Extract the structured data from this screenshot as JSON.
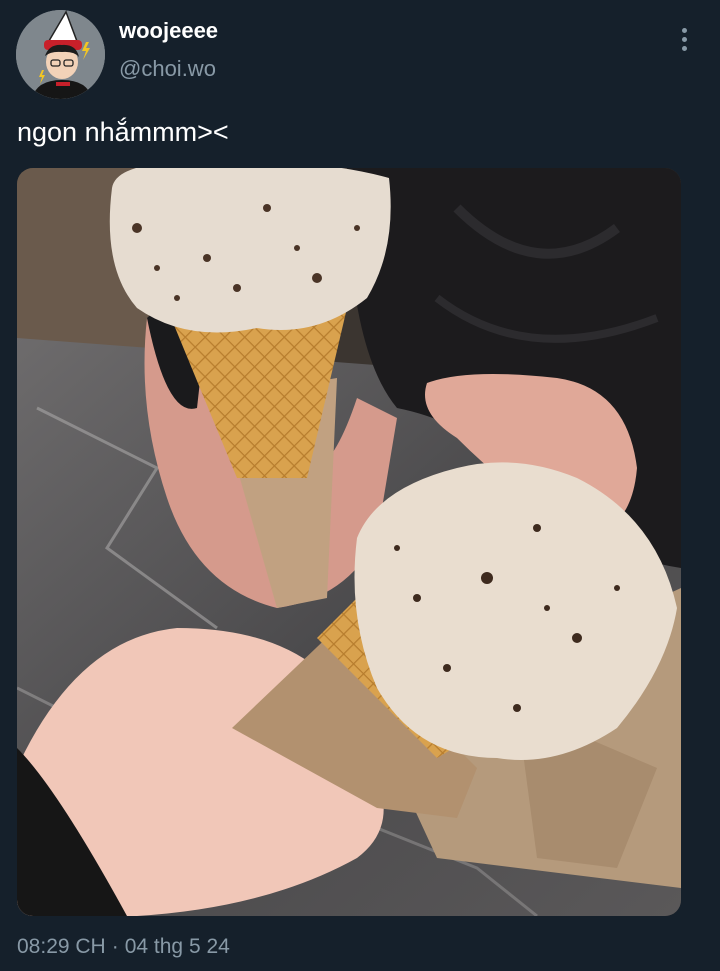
{
  "author": {
    "display_name": "woojeeee",
    "handle": "@choi.wo",
    "avatar_icon": "user-avatar"
  },
  "more_icon": "vertical-ellipsis-icon",
  "tweet": {
    "text": "ngon nhắmmm><",
    "media_icon": "ice-cream-cones-photo"
  },
  "meta": {
    "time": "08:29 CH",
    "separator": "·",
    "date": "04 thg 5 24"
  },
  "colors": {
    "background": "#15202b",
    "primary_text": "#ffffff",
    "secondary_text": "#8899a6"
  }
}
